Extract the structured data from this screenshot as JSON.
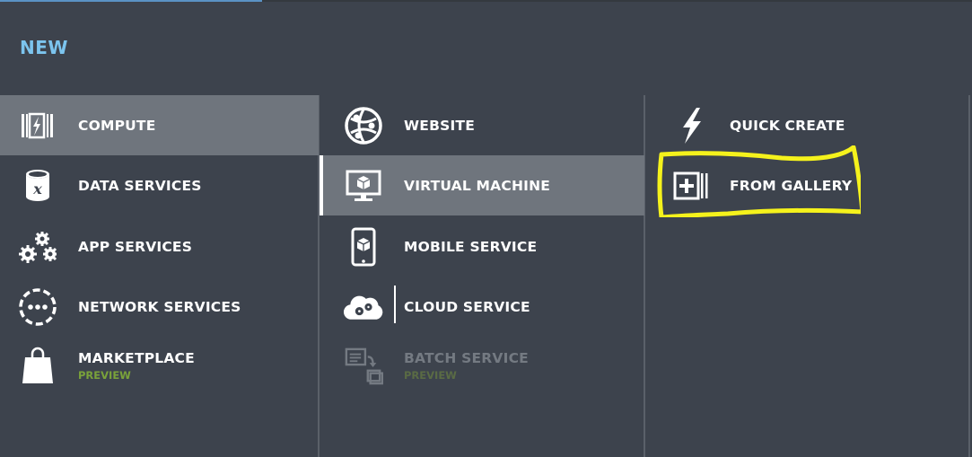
{
  "header": {
    "title": "NEW"
  },
  "columns": {
    "categories": [
      {
        "label": "COMPUTE",
        "icon": "compute-icon",
        "selected": true
      },
      {
        "label": "DATA SERVICES",
        "icon": "database-icon"
      },
      {
        "label": "APP SERVICES",
        "icon": "gears-icon"
      },
      {
        "label": "NETWORK SERVICES",
        "icon": "network-icon"
      },
      {
        "label": "MARKETPLACE",
        "sub": "PREVIEW",
        "icon": "shopping-bag-icon"
      }
    ],
    "compute": [
      {
        "label": "WEBSITE",
        "icon": "globe-icon"
      },
      {
        "label": "VIRTUAL MACHINE",
        "icon": "monitor-icon",
        "selected": true
      },
      {
        "label": "MOBILE SERVICE",
        "icon": "mobile-icon"
      },
      {
        "label": "CLOUD SERVICE",
        "icon": "cloud-icon"
      },
      {
        "label": "BATCH SERVICE",
        "sub": "PREVIEW",
        "icon": "batch-icon",
        "disabled": true
      }
    ],
    "vm_options": [
      {
        "label": "QUICK CREATE",
        "icon": "lightning-icon"
      },
      {
        "label": "FROM GALLERY",
        "icon": "gallery-plus-icon"
      }
    ]
  },
  "colors": {
    "background": "#3d434d",
    "selected": "#6f757d",
    "title": "#7cc4ee",
    "preview": "#7aa23a",
    "highlight": "#f5f21c"
  }
}
